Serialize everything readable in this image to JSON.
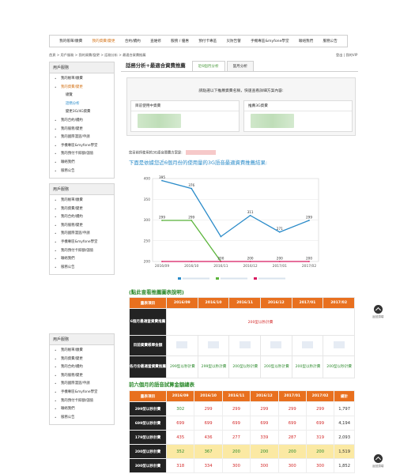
{
  "topnav": [
    "我的帳單/繳費",
    "我的資費/變更",
    "合約/續約",
    "查維修",
    "服務 / 優惠",
    "預付卡專區",
    "災防告警",
    "手機專區&myfone學堂",
    "聯絡我們",
    "服務公告"
  ],
  "topnav_active_index": 1,
  "breadcrumb": "首頁 > 用戶服務 > 我的資費/變更 > 話務分析 > 最適合資費推薦",
  "toplinks": "登出 | 我的VIP",
  "sidebar1": {
    "title": "用戶服務",
    "items": [
      {
        "label": "我的帳單/繳費"
      },
      {
        "label": "我的資費/變更",
        "color": "orange"
      },
      {
        "label": "總覽",
        "sub": true
      },
      {
        "label": "話務分析",
        "sub": true,
        "active": true
      },
      {
        "label": "變更3G/4G資費",
        "sub": true
      },
      {
        "label": "我的合約/續約"
      },
      {
        "label": "我的服務/變更"
      },
      {
        "label": "我的國際漫遊/申請"
      },
      {
        "label": "手機專區&myfone學堂"
      },
      {
        "label": "我的預付卡餘額/儲值"
      },
      {
        "label": "聯絡我們"
      },
      {
        "label": "服務公告"
      }
    ]
  },
  "sidebar2": {
    "title": "用戶服務",
    "items": [
      "我的帳單/繳費",
      "我的資費/變更",
      "我的合約/續約",
      "我的服務/變更",
      "我的國際漫遊/申請",
      "手機專區&myfone學堂",
      "我的預付卡餘額/儲值",
      "聯絡我們",
      "服務公告"
    ]
  },
  "sidebar3": {
    "title": "用戶服務",
    "items": [
      "我的帳單/繳費",
      "我的資費/變更",
      "我的合約/續約",
      "我的服務/變更",
      "我的國際漫遊/申請",
      "手機專區&myfone學堂",
      "我的預付卡餘額/儲值",
      "聯絡我們",
      "服務公告"
    ]
  },
  "tabs": {
    "title": "話務分析+最適合資費推薦",
    "tab1": "近6個月分析",
    "tab2": "當月分析"
  },
  "panel": {
    "hint": "請點選以下推薦資費名稱，快速查看詳細方案內容:",
    "left_label": "目前使用中資費",
    "right_label": "推薦3G資費"
  },
  "section_small": "您目前所使用的3G語音資費方案是:",
  "section_big": "下面是依據您近6個月份的使用量的3G語音最適資費推薦結果:",
  "chart_data": {
    "type": "line",
    "categories": [
      "2016/09",
      "2016/10",
      "2016/11",
      "2016/12",
      "2017/01",
      "2017/02"
    ],
    "ylim": [
      200,
      400
    ],
    "yticks": [
      200,
      250,
      300,
      350,
      400
    ],
    "ylabel": "",
    "series": [
      {
        "color": "#2a8bc9",
        "values": [
          395,
          376,
          260,
          311,
          271,
          299
        ],
        "labels": [
          "395",
          "376",
          "",
          "311",
          "271",
          "299"
        ]
      },
      {
        "color": "#5cb53c",
        "values": [
          299,
          299,
          200,
          null,
          null,
          null
        ],
        "labels": [
          "299",
          "299",
          "",
          "",
          "",
          ""
        ]
      },
      {
        "color": "#d81b60",
        "values": [
          200,
          200,
          200,
          200,
          200,
          200
        ],
        "labels": [
          "",
          "",
          "200",
          "200",
          "200",
          "200"
        ]
      }
    ]
  },
  "link_text": "(點此查看推薦圖表說明)",
  "table1": {
    "headers": [
      "畫表項目",
      "2016/09",
      "2016/10",
      "2016/11",
      "2016/12",
      "2017/01",
      "2017/02"
    ],
    "row1_label": "6個月最適當資費推薦",
    "row1_value": "200型以秒計費",
    "row2_label": "目前資費帳單金額",
    "row3_label": "各月份最適當資費推薦",
    "row3_values": [
      "299型以秒計費",
      "299型以秒計費",
      "200型以秒計費",
      "200型以秒計費",
      "200型以秒計費",
      "200型以秒計費"
    ]
  },
  "section2": "前六個月的語音試算金額總表",
  "table2": {
    "headers": [
      "畫表項目",
      "2016/09",
      "2016/10",
      "2016/11",
      "2016/12",
      "2017/01",
      "2017/02",
      "總計"
    ],
    "rows": [
      {
        "label": "299型以秒計費",
        "values": [
          "302",
          "299",
          "299",
          "299",
          "299",
          "299"
        ],
        "total": "1,797",
        "ok": [
          true,
          false,
          false,
          false,
          false,
          false
        ]
      },
      {
        "label": "699型以秒計費",
        "values": [
          "699",
          "699",
          "699",
          "699",
          "699",
          "699"
        ],
        "total": "4,194",
        "ok": [
          false,
          false,
          false,
          false,
          false,
          false
        ]
      },
      {
        "label": "179型以秒計費",
        "values": [
          "435",
          "436",
          "277",
          "339",
          "287",
          "319"
        ],
        "total": "2,093",
        "ok": [
          false,
          false,
          false,
          false,
          false,
          false
        ]
      },
      {
        "label": "200型以秒計費",
        "values": [
          "352",
          "367",
          "200",
          "200",
          "200",
          "200"
        ],
        "total": "1,519",
        "ok": [
          true,
          true,
          true,
          true,
          true,
          true
        ],
        "highlight": true
      },
      {
        "label": "300型以秒計費",
        "values": [
          "318",
          "334",
          "300",
          "300",
          "300",
          "300"
        ],
        "total": "1,852",
        "ok": [
          false,
          false,
          false,
          false,
          false,
          false
        ]
      }
    ]
  },
  "to_top_label": "返回頂端"
}
